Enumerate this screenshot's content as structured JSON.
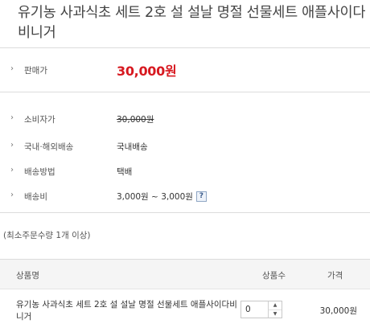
{
  "product": {
    "title": "유기농 사과식초 세트 2호 설 설날 명절 선물세트 애플사이다비니거"
  },
  "info": {
    "chevron": "›",
    "sale_price": {
      "label": "판매가",
      "value": "30,000원"
    },
    "consumer_price": {
      "label": "소비자가",
      "value": "30,000원"
    },
    "shipping_type": {
      "label": "국내·해외배송",
      "value": "국내배송"
    },
    "shipping_method": {
      "label": "배송방법",
      "value": "택배"
    },
    "shipping_fee": {
      "label": "배송비",
      "value": "3,000원 ~ 3,000원",
      "help": "?"
    }
  },
  "min_order": "(최소주문수량 1개 이상)",
  "table": {
    "headers": {
      "name": "상품명",
      "qty": "상품수",
      "price": "가격"
    },
    "row": {
      "name": "유기농 사과식초 세트 2호 설 설날 명절 선물세트 애플사이다비니거",
      "qty": "0",
      "price": "30,000원"
    },
    "stepper": {
      "up": "▲",
      "down": "▼"
    }
  },
  "colors": {
    "price_red": "#d71920",
    "border": "#dcdcdc",
    "header_bg": "#f5f5f5"
  }
}
